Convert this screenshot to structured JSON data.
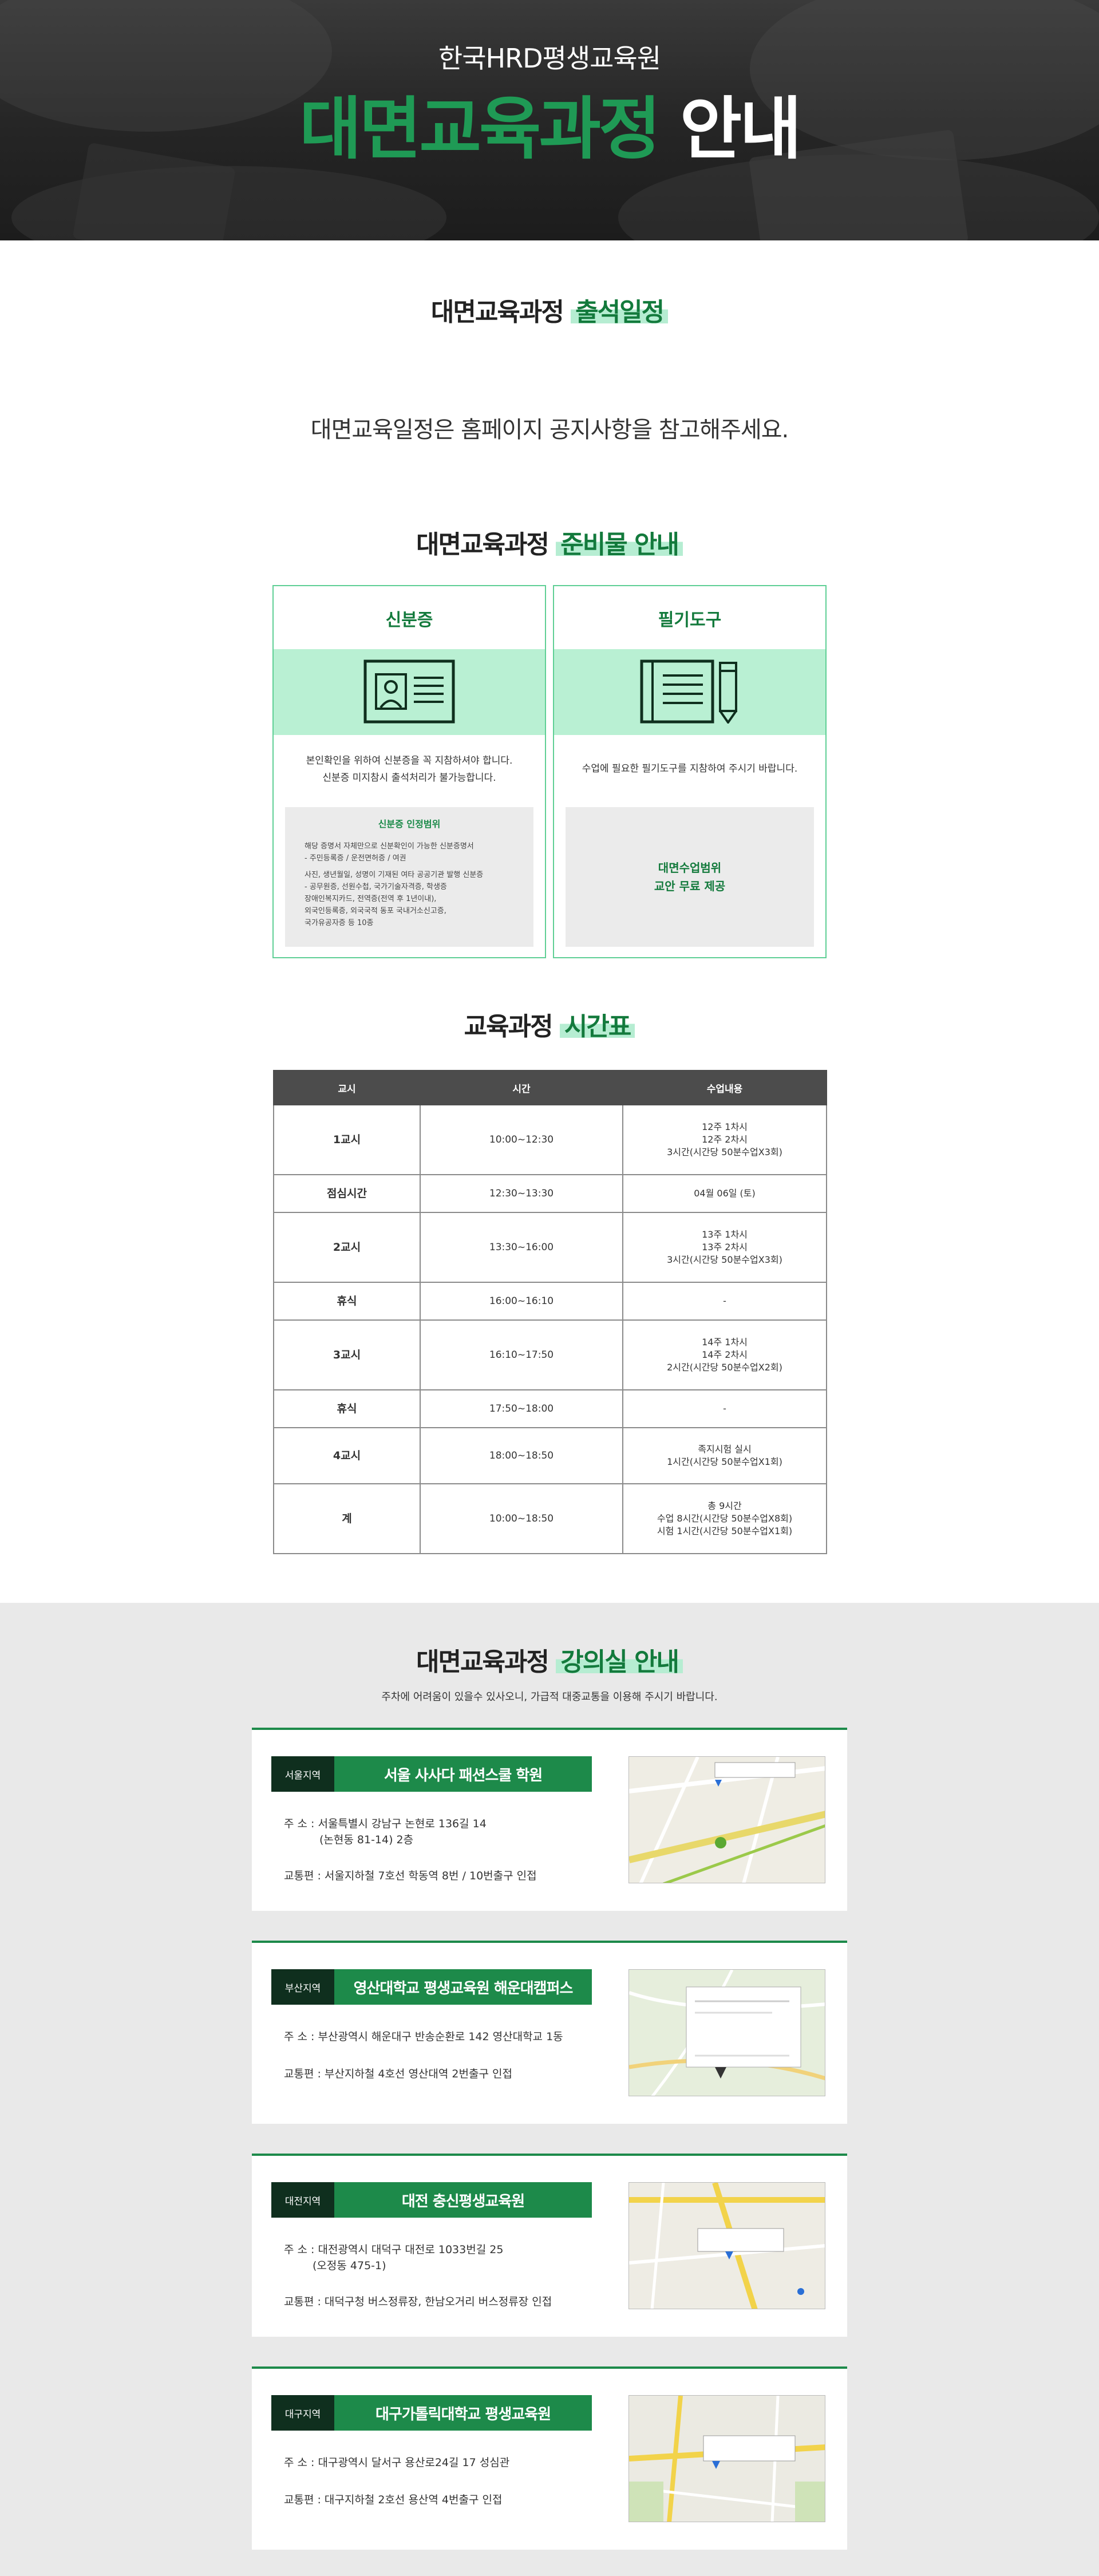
{
  "hero": {
    "subtitle": "한국HRD평생교육원",
    "title_green": "대면교육과정",
    "title_white": "안내"
  },
  "attendance": {
    "title_plain": "대면교육과정",
    "title_highlight": "출석일정",
    "notice": "대면교육일정은 홈페이지 공지사항을 참고해주세요."
  },
  "prep": {
    "title_plain": "대면교육과정",
    "title_highlight": "준비물 안내",
    "cards": [
      {
        "title": "신분증",
        "icon": "id-card-icon",
        "desc_line1": "본인확인을 위하여 신분증을 꼭 지참하셔야 합니다.",
        "desc_line2": "신분증 미지참시 출석처리가 불가능합니다.",
        "box_title": "신분증 인정범위",
        "box_lines": [
          "해당 증명서 자체만으로 신분확인이 가능한 신분증명서",
          "- 주민등록증 / 운전면허증 / 여권",
          "사진, 생년월일, 성명이 기재된 여타 공공기관 발행 신분증",
          "- 공무원증, 선원수첩, 국가기술자격증, 학생증",
          "장애인복지카드, 전역증(전역 후 1년이내),",
          "외국인등록증, 외국국적 동포 국내거소신고증,",
          "국가유공자증 등 10종"
        ]
      },
      {
        "title": "필기도구",
        "icon": "notebook-pencil-icon",
        "desc_line1": "수업에 필요한 필기도구를 지참하여 주시기 바랍니다.",
        "box_line1": "대면수업범위",
        "box_line2": "교안 무료 제공"
      }
    ]
  },
  "timetable": {
    "title_plain": "교육과정",
    "title_highlight": "시간표",
    "headers": [
      "교시",
      "시간",
      "수업내용"
    ],
    "rows": [
      {
        "period": "1교시",
        "time": "10:00~12:30",
        "content": [
          "12주 1차시",
          "12주 2차시",
          "3시간(시간당 50분수업X3회)"
        ]
      },
      {
        "period": "점심시간",
        "time": "12:30~13:30",
        "content": [
          "04월 06일 (토)"
        ]
      },
      {
        "period": "2교시",
        "time": "13:30~16:00",
        "content": [
          "13주 1차시",
          "13주 2차시",
          "3시간(시간당 50분수업X3회)"
        ]
      },
      {
        "period": "휴식",
        "time": "16:00~16:10",
        "content": [
          "-"
        ]
      },
      {
        "period": "3교시",
        "time": "16:10~17:50",
        "content": [
          "14주 1차시",
          "14주 2차시",
          "2시간(시간당 50분수업X2회)"
        ]
      },
      {
        "period": "휴식",
        "time": "17:50~18:00",
        "content": [
          "-"
        ]
      },
      {
        "period": "4교시",
        "time": "18:00~18:50",
        "content": [
          "족지시험 실시",
          "1시간(시간당 50분수업X1회)"
        ]
      },
      {
        "period": "계",
        "time": "10:00~18:50",
        "content": [
          "총 9시간",
          "수업 8시간(시간당 50분수업X8회)",
          "시험 1시간(시간당 50분수업X1회)"
        ]
      }
    ]
  },
  "classroom": {
    "title_plain": "대면교육과정",
    "title_highlight": "강의실 안내",
    "notice": "주차에 어려움이 있을수 있사오니, 가급적 대중교통을 이용해 주시기 바랍니다.",
    "locations": [
      {
        "region": "서울지역",
        "name": "서울 사사다 패션스쿨 학원",
        "addr_line1": "주   소 : 서울특별시 강남구 논현로 136길 14",
        "addr_line2": "(논현동 81-14) 2층",
        "traffic": "교통편 : 서울지하철 7호선 학동역 8번 / 10번출구 인접"
      },
      {
        "region": "부산지역",
        "name": "영산대학교 평생교육원 해운대캠퍼스",
        "addr_line1": "주   소 : 부산광역시 해운대구 반송순환로 142 영산대학교 1동",
        "addr_line2": "",
        "traffic": "교통편 : 부산지하철 4호선 영산대역 2번출구 인접"
      },
      {
        "region": "대전지역",
        "name": "대전 충신평생교육원",
        "addr_line1": "주   소 : 대전광역시 대덕구 대전로 1033번길 25",
        "addr_line2": "(오정동 475-1)",
        "traffic": "교통편 : 대덕구청 버스정류장, 한남오거리 버스정류장 인접"
      },
      {
        "region": "대구지역",
        "name": "대구가톨릭대학교 평생교육원",
        "addr_line1": "주   소 : 대구광역시 달서구 용산로24길 17 성심관",
        "addr_line2": "",
        "traffic": "교통편 : 대구지하철 2호선 용산역 4번출구 인접"
      }
    ]
  },
  "colors": {
    "brand_green": "#1d8a4a",
    "light_mint": "#b9f0d3",
    "dark_header": "#4c4c4c"
  }
}
